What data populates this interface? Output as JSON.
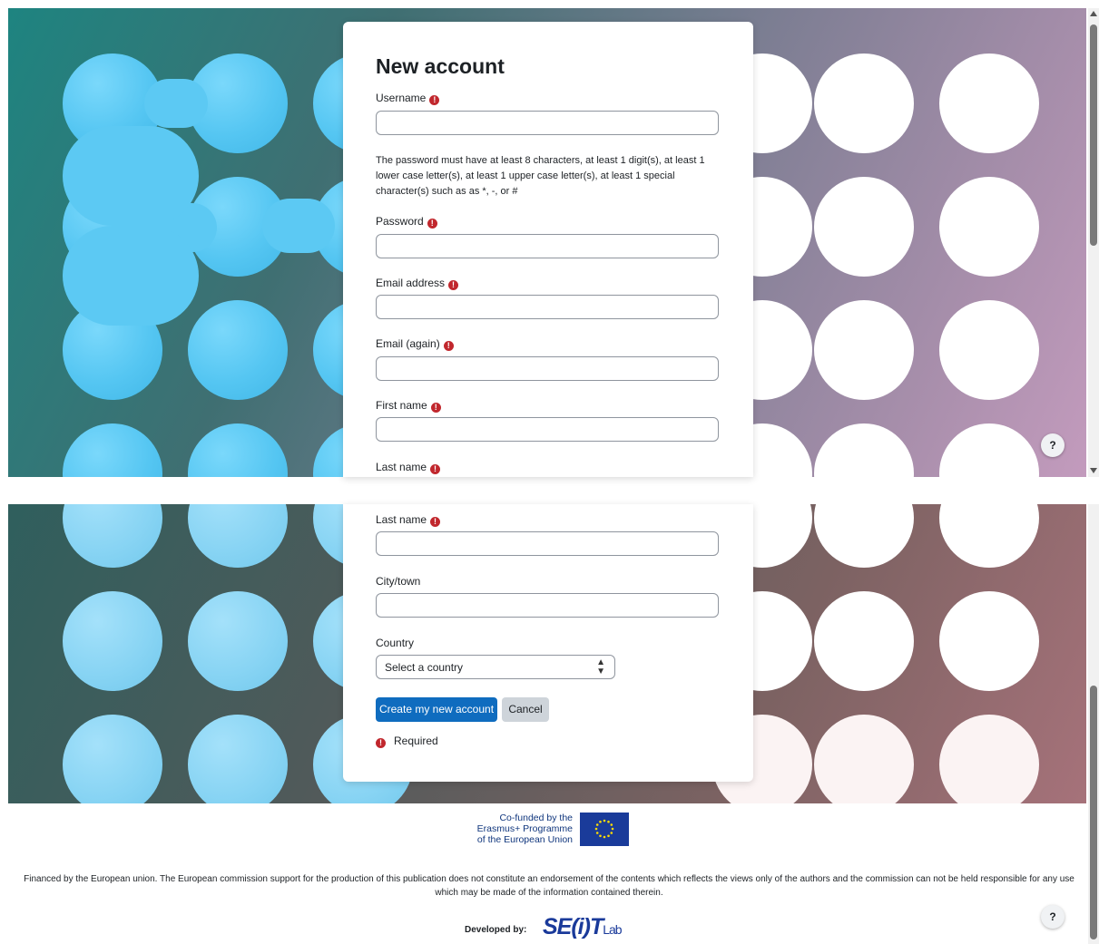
{
  "form": {
    "title": "New account",
    "username_label": "Username",
    "password_hint": "The password must have at least 8 characters, at least 1 digit(s), at least 1 lower case letter(s), at least 1 upper case letter(s), at least 1 special character(s) such as as *, -, or #",
    "password_label": "Password",
    "email_label": "Email address",
    "email_again_label": "Email (again)",
    "first_name_label": "First name",
    "last_name_label": "Last name",
    "city_label": "City/town",
    "country_label": "Country",
    "country_value": "Select a country",
    "submit_label": "Create my new account",
    "cancel_label": "Cancel",
    "required_legend": "Required",
    "required_icon": "exclamation-circle-icon"
  },
  "help_button": {
    "label": "?"
  },
  "footer": {
    "eu_line1": "Co-funded by the",
    "eu_line2": "Erasmus+ Programme",
    "eu_line3": "of the European Union",
    "disclaimer": "Financed by the European union. The European commission support for the production of this publication does not constitute an endorsement of the contents which reflects the views only of the authors and the commission can not be held responsible for any use which may be made of the information contained therein.",
    "developed_by": "Developed by:",
    "developer_logo": "SE(i)TLab"
  },
  "colors": {
    "primary": "#0f6cbf",
    "required": "#c1272d",
    "eu_blue": "#1a3b9a",
    "eu_star": "#ffdd00"
  }
}
